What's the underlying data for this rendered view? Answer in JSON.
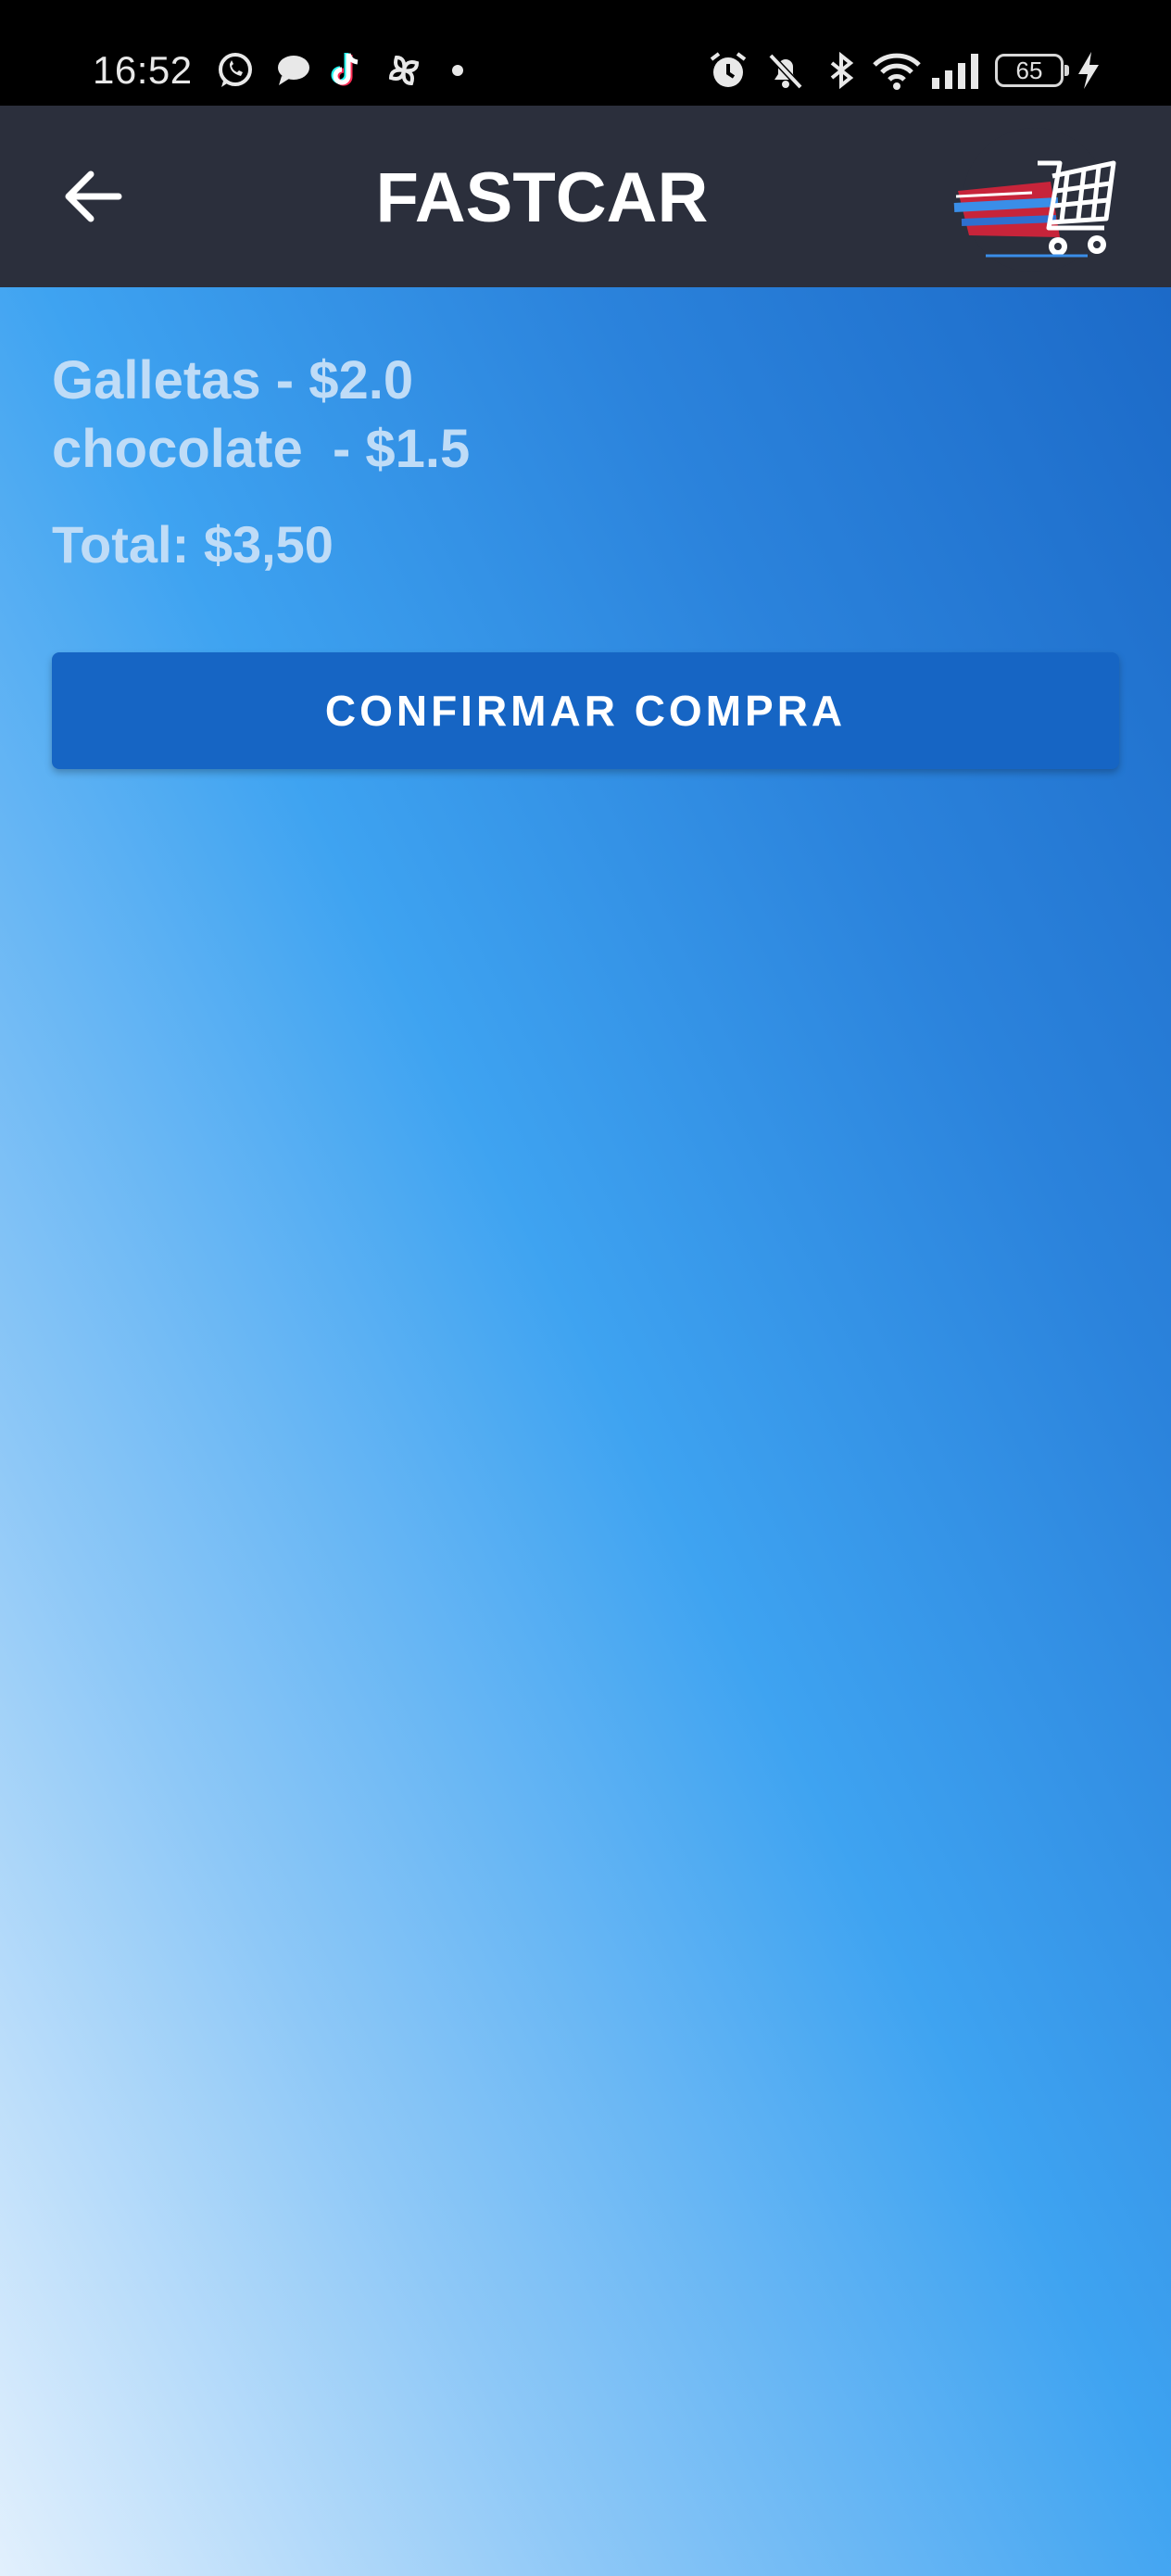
{
  "status_bar": {
    "time": "16:52",
    "battery": "65",
    "left_icons": [
      "whatsapp-icon",
      "chat-bubble-icon",
      "tiktok-icon",
      "pinwheel-icon",
      "dot-icon"
    ],
    "right_icons": [
      "alarm-icon",
      "bell-off-icon",
      "bluetooth-icon",
      "wifi-icon",
      "signal-icon",
      "battery-icon",
      "charging-icon"
    ]
  },
  "app_bar": {
    "title": "FASTCAR",
    "back_icon": "arrow-left-icon",
    "logo": "shopping-cart-logo"
  },
  "cart": {
    "items": [
      {
        "text": "Galletas - $2.0"
      },
      {
        "text": "chocolate  - $1.5"
      }
    ],
    "total": "Total: $3,50",
    "confirm_label": "CONFIRMAR COMPRA"
  },
  "colors": {
    "app_bar": "#2b2f3c",
    "button": "#1665c4",
    "item_text": "#bfdcf7",
    "gradient": [
      "#1c6ac8",
      "#3ea3f1",
      "#e2f0fd"
    ]
  }
}
